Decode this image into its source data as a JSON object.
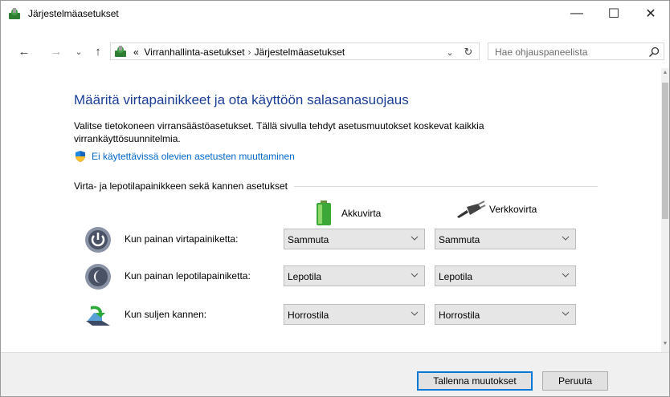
{
  "window": {
    "title": "Järjestelmäasetukset",
    "minimize_glyph": "—",
    "maximize_glyph": "☐",
    "close_glyph": "✕"
  },
  "nav": {
    "back_glyph": "←",
    "forward_glyph": "→",
    "recent_glyph": "⌄",
    "up_glyph": "↑",
    "address_prefix": "«",
    "breadcrumb": [
      "Virranhallinta-asetukset",
      "Järjestelmäasetukset"
    ],
    "breadcrumb_separator": "›",
    "address_dropdown_glyph": "⌄",
    "refresh_glyph": "↻",
    "search_placeholder": "Hae ohjauspaneelista"
  },
  "main": {
    "heading": "Määritä virtapainikkeet ja ota käyttöön salasanasuojaus",
    "description": "Valitse tietokoneen virransäästöasetukset. Tällä sivulla tehdyt asetusmuutokset koskevat kaikkia virrankäyttösuunnitelmia.",
    "admin_link": "Ei käytettävissä olevien asetusten muuttaminen",
    "section_title": "Virta- ja lepotilapainikkeen sekä kannen asetukset",
    "columns": {
      "battery": "Akkuvirta",
      "plugged": "Verkkovirta"
    },
    "rows": [
      {
        "label": "Kun painan virtapainiketta:",
        "battery": "Sammuta",
        "plugged": "Sammuta",
        "icon": "power-button-icon"
      },
      {
        "label": "Kun painan lepotilapainiketta:",
        "battery": "Lepotila",
        "plugged": "Lepotila",
        "icon": "sleep-button-icon"
      },
      {
        "label": "Kun suljen kannen:",
        "battery": "Horrostila",
        "plugged": "Horrostila",
        "icon": "laptop-lid-icon"
      }
    ]
  },
  "footer": {
    "save_label": "Tallenna muutokset",
    "cancel_label": "Peruuta"
  },
  "colors": {
    "heading": "#1a3e96",
    "link": "#0066cc",
    "primary_button_border": "#0078d7"
  }
}
